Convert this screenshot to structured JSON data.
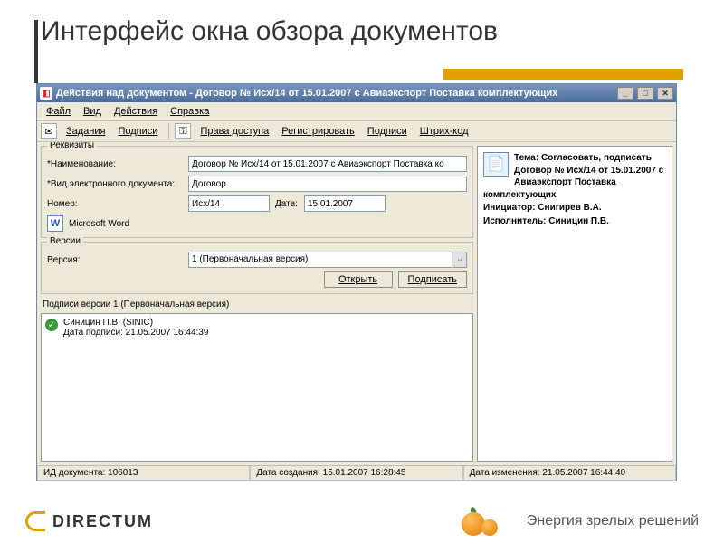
{
  "slide": {
    "title": "Интерфейс окна обзора документов"
  },
  "window": {
    "title": "Действия над документом - Договор № Исх/14 от 15.01.2007 с Авиаэкспорт Поставка комплектующих",
    "menu": {
      "file": "Файл",
      "view": "Вид",
      "actions": "Действия",
      "help": "Справка"
    },
    "toolbar": {
      "tasks": "Задания",
      "signatures": "Подписи",
      "access": "Права доступа",
      "register": "Регистрировать",
      "sign": "Подписи",
      "barcode": "Штрих-код"
    }
  },
  "props": {
    "group": "Реквизиты",
    "name_label": "*Наименование:",
    "name_value": "Договор № Исх/14 от 15.01.2007 с Авиаэкспорт Поставка ко",
    "kind_label": "*Вид электронного документа:",
    "kind_value": "Договор",
    "num_label": "Номер:",
    "num_value": "Исх/14",
    "date_label": "Дата:",
    "date_value": "15.01.2007",
    "app_label": "Microsoft Word"
  },
  "versions": {
    "group": "Версии",
    "label": "Версия:",
    "value": "1 (Первоначальная версия)",
    "open": "Открыть",
    "sign": "Подписать"
  },
  "sign": {
    "title": "Подписи версии 1 (Первоначальная версия)",
    "signer": "Синицин П.В. (SINIC)",
    "when": "Дата подписи: 21.05.2007 16:44:39"
  },
  "task": {
    "theme_label": "Тема: ",
    "theme": "Согласовать, подписать Договор № Исх/14 от 15.01.2007 с Авиаэкспорт Поставка комплектующих",
    "initiator_label": "Инициатор: ",
    "initiator": "Снигирев В.А.",
    "performer_label": "Исполнитель: ",
    "performer": "Синицин П.В."
  },
  "status": {
    "id": "ИД документа: 106013",
    "created": "Дата создания: 15.01.2007 16:28:45",
    "modified": "Дата изменения: 21.05.2007 16:44:40"
  },
  "footer": {
    "brand": "DIRECTUM",
    "slogan": "Энергия зрелых решений"
  }
}
